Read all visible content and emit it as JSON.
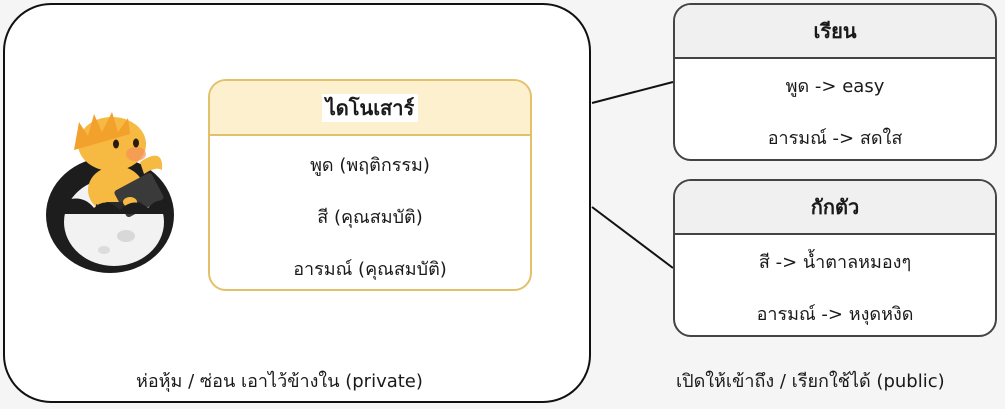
{
  "main_class": {
    "title": "ไดโนเสาร์",
    "rows": [
      "พูด (พฤติกรรม)",
      "สี (คุณสมบัติ)",
      "อารมณ์ (คุณสมบัติ)"
    ]
  },
  "boxes": [
    {
      "title": "เรียน",
      "rows": [
        "พูด -> easy",
        "อารมณ์ -> สดใส"
      ]
    },
    {
      "title": "กักตัว",
      "rows": [
        "สี -> น้ำตาลหมองๆ",
        "อารมณ์ -> หงุดหงิด"
      ]
    }
  ],
  "captions": {
    "private": "ห่อหุ้ม / ซ่อน เอาไว้ข้างใน (private)",
    "public": "เปิดให้เข้าถึง / เรียกใช้ได้ (public)"
  },
  "colors": {
    "class_border": "#e2c16a",
    "class_header_fill": "#fdf0cf",
    "side_header_fill": "#f0f0f0",
    "dino_body": "#f6b941"
  },
  "icons": {
    "mascot": "dinosaur-in-eggshell-with-laptop-icon"
  }
}
